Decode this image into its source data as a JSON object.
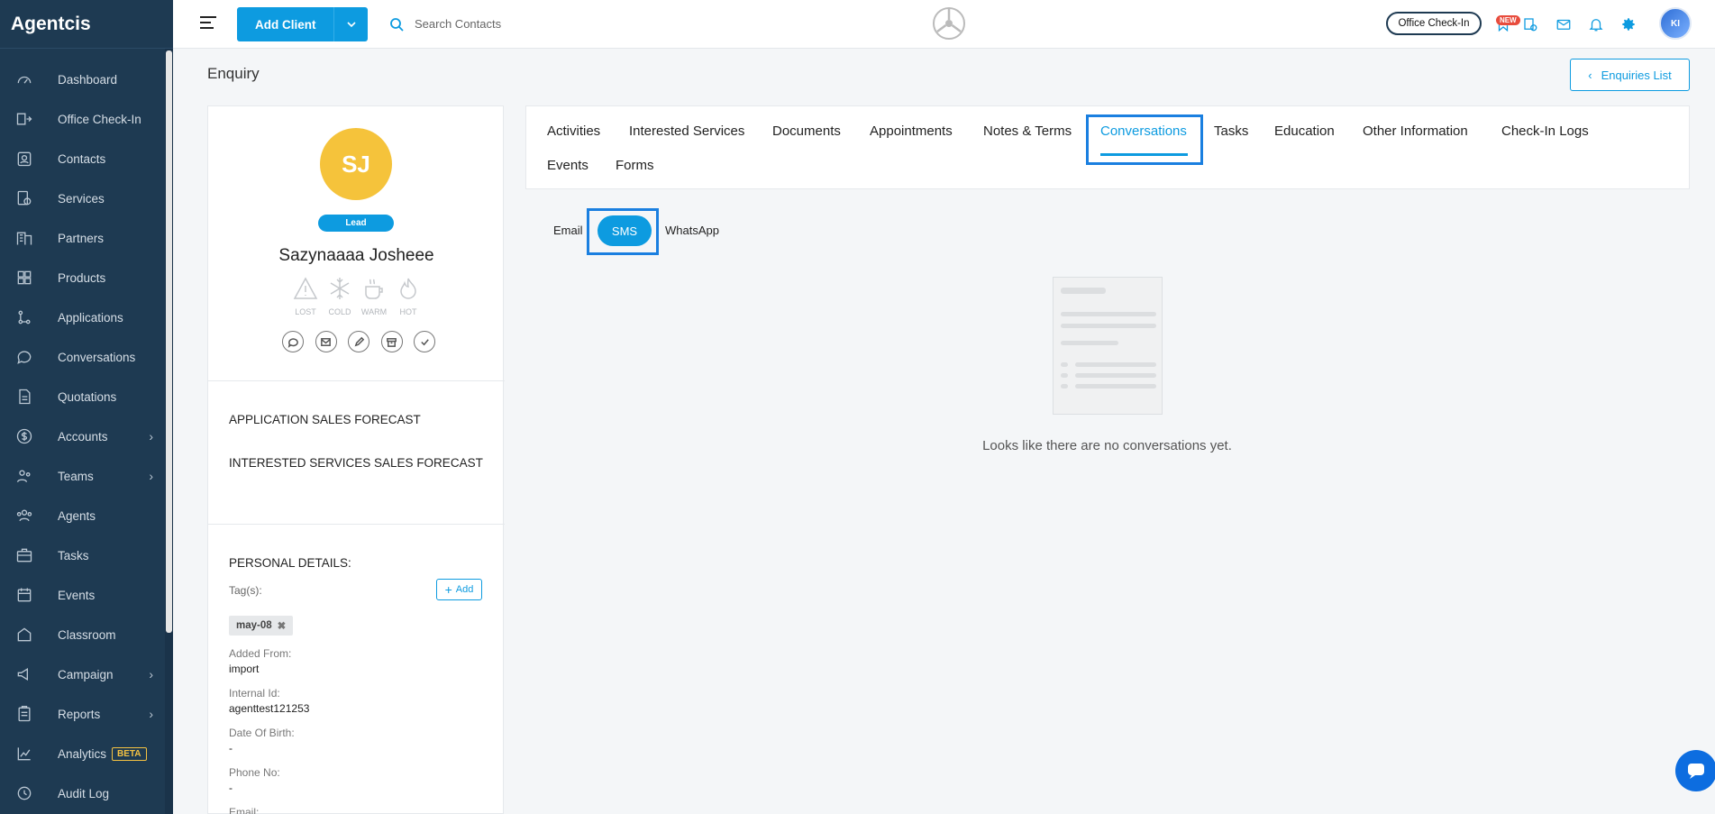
{
  "app": {
    "brand": "Agentcis"
  },
  "sidebar": {
    "items": [
      {
        "label": "Dashboard",
        "icon": "gauge-icon",
        "has_submenu": false
      },
      {
        "label": "Office Check-In",
        "icon": "checkin-icon",
        "has_submenu": false
      },
      {
        "label": "Contacts",
        "icon": "contacts-icon",
        "has_submenu": false
      },
      {
        "label": "Services",
        "icon": "services-icon",
        "has_submenu": false
      },
      {
        "label": "Partners",
        "icon": "building-icon",
        "has_submenu": false
      },
      {
        "label": "Products",
        "icon": "grid-icon",
        "has_submenu": false
      },
      {
        "label": "Applications",
        "icon": "flow-icon",
        "has_submenu": false
      },
      {
        "label": "Conversations",
        "icon": "chat-icon",
        "has_submenu": false
      },
      {
        "label": "Quotations",
        "icon": "document-icon",
        "has_submenu": false
      },
      {
        "label": "Accounts",
        "icon": "dollar-icon",
        "has_submenu": true
      },
      {
        "label": "Teams",
        "icon": "team-icon",
        "has_submenu": true
      },
      {
        "label": "Agents",
        "icon": "agents-icon",
        "has_submenu": false
      },
      {
        "label": "Tasks",
        "icon": "briefcase-icon",
        "has_submenu": false
      },
      {
        "label": "Events",
        "icon": "calendar-icon",
        "has_submenu": false
      },
      {
        "label": "Classroom",
        "icon": "classroom-icon",
        "has_submenu": false
      },
      {
        "label": "Campaign",
        "icon": "megaphone-icon",
        "has_submenu": true
      },
      {
        "label": "Reports",
        "icon": "clipboard-icon",
        "has_submenu": true
      },
      {
        "label": "Analytics",
        "icon": "analytics-icon",
        "has_submenu": false,
        "badge": "BETA"
      },
      {
        "label": "Audit Log",
        "icon": "audit-icon",
        "has_submenu": false
      }
    ]
  },
  "topbar": {
    "add_client_label": "Add Client",
    "search_placeholder": "Search Contacts",
    "office_checkin_label": "Office Check-In",
    "new_badge": "NEW",
    "avatar_initials": "KI"
  },
  "page": {
    "title": "Enquiry",
    "enquiries_list_label": "Enquiries List"
  },
  "profile": {
    "initials": "SJ",
    "status_badge": "Lead",
    "name": "Sazynaaaa Josheee",
    "temperatures": [
      "LOST",
      "COLD",
      "WARM",
      "HOT"
    ],
    "forecast_application": "APPLICATION SALES FORECAST",
    "forecast_services": "INTERESTED SERVICES SALES FORECAST",
    "personal_details_title": "PERSONAL DETAILS:",
    "tags_label": "Tag(s):",
    "add_label": "Add",
    "tag": "may-08",
    "fields": [
      {
        "label": "Added From:",
        "value": "import"
      },
      {
        "label": "Internal Id:",
        "value": "agenttest121253"
      },
      {
        "label": "Date Of Birth:",
        "value": "-"
      },
      {
        "label": "Phone No:",
        "value": "-"
      },
      {
        "label": "Email:",
        "value": ""
      }
    ]
  },
  "tabs": [
    "Activities",
    "Interested Services",
    "Documents",
    "Appointments",
    "Notes & Terms",
    "Conversations",
    "Tasks",
    "Education",
    "Other Information",
    "Check-In Logs",
    "Events",
    "Forms"
  ],
  "active_tab": "Conversations",
  "channels": {
    "email": "Email",
    "sms": "SMS",
    "whatsapp": "WhatsApp",
    "active": "SMS"
  },
  "empty_state": {
    "message": "Looks like there are no conversations yet."
  },
  "colors": {
    "primary": "#0d9be0",
    "sidebar": "#1e3a52",
    "highlight": "#1a7fe0",
    "avatar": "#f5c33b"
  }
}
